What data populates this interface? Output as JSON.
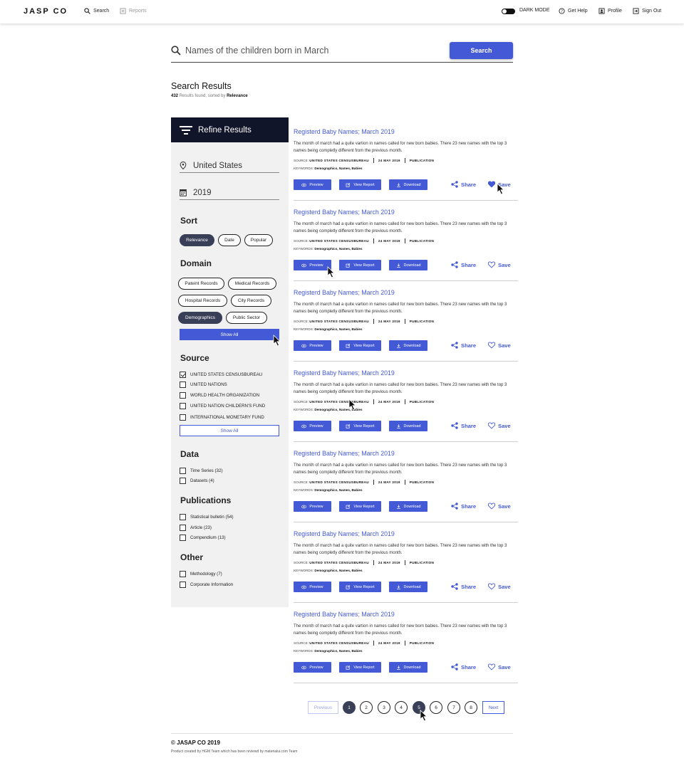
{
  "header": {
    "logo": "JASP CO",
    "nav": {
      "search": "Search",
      "reports": "Reports"
    },
    "dark_mode_label": "DARK MODE",
    "get_help": "Get Help",
    "profile": "Profile",
    "sign_out": "Sign Out"
  },
  "search": {
    "query": "Names of the children born in March",
    "button_label": "Search"
  },
  "results_header": {
    "title": "Search Results",
    "count": "432",
    "found_text": "Results found, sorted by",
    "sort_by": "Relevance"
  },
  "sidebar": {
    "title": "Refine Results",
    "location": "United States",
    "year": "2019",
    "sort": {
      "title": "Sort",
      "options": [
        "Relevance",
        "Date",
        "Popular"
      ],
      "selected": "Relevance"
    },
    "domain": {
      "title": "Domain",
      "chips": [
        "Pateint Records",
        "Medical Records",
        "Hospital Records",
        "City Records",
        "Demographics",
        "Public Sector"
      ],
      "selected": "Demographics",
      "show_all": "Show All"
    },
    "source": {
      "title": "Source",
      "items": [
        {
          "label": "UNITED STATES CENSUSBUREAU",
          "checked": true
        },
        {
          "label": "UNITED NATIONS",
          "checked": false
        },
        {
          "label": "WORLD HEALTH ORGANIZATION",
          "checked": false
        },
        {
          "label": "UNITED NATION CHILDERN'S FUND",
          "checked": false
        },
        {
          "label": "INTERNATIONAL MONETARY FUND",
          "checked": false
        }
      ],
      "show_all": "Show All"
    },
    "data": {
      "title": "Data",
      "items": [
        {
          "label": "Time Series (32)",
          "checked": false
        },
        {
          "label": "Datasets (4)",
          "checked": false
        }
      ]
    },
    "publications": {
      "title": "Publications",
      "items": [
        {
          "label": "Statistical bulletin (54)",
          "checked": false
        },
        {
          "label": "Article (23)",
          "checked": false
        },
        {
          "label": "Compendium (13)",
          "checked": false
        }
      ]
    },
    "other": {
      "title": "Other",
      "items": [
        {
          "label": "Methodology (7)",
          "checked": false
        },
        {
          "label": "Corporate Information",
          "checked": false
        }
      ]
    }
  },
  "result_template": {
    "title": "Registerd Baby Names; March 2019",
    "description": "The month of march had a quite vartion in names called for new born babies. There 23 new names with the top 3 names being completly different from the previous month.",
    "source_label": "SOURCE:",
    "source": "UNITED STATES CENSUSBUREAU",
    "date": "24 MAY 2019",
    "type": "PUBLICATION",
    "keywords_label": "KEYWORDS:",
    "keywords": "Demographics, Names, Babies",
    "preview": "Preview",
    "view_report": "View Report",
    "download": "Download",
    "share": "Share",
    "save": "Save"
  },
  "results": [
    {
      "saved": true
    },
    {
      "saved": false
    },
    {
      "saved": false
    },
    {
      "saved": false
    },
    {
      "saved": false
    },
    {
      "saved": false
    },
    {
      "saved": false
    }
  ],
  "pagination": {
    "previous": "Previous",
    "next": "Next",
    "pages": [
      "1",
      "2",
      "3",
      "4",
      "5",
      "6",
      "7",
      "8"
    ],
    "current": "1",
    "hover": "5"
  },
  "footer": {
    "copyright": "© JASAP CO 2019",
    "credit": "Product created by HGM Team which has been reviewd by materialui.com Team"
  },
  "colors": {
    "accent": "#4459d6",
    "dark": "#11152a",
    "chip_active": "#3a3f58",
    "sidebar_bg": "#f1f1f1"
  }
}
